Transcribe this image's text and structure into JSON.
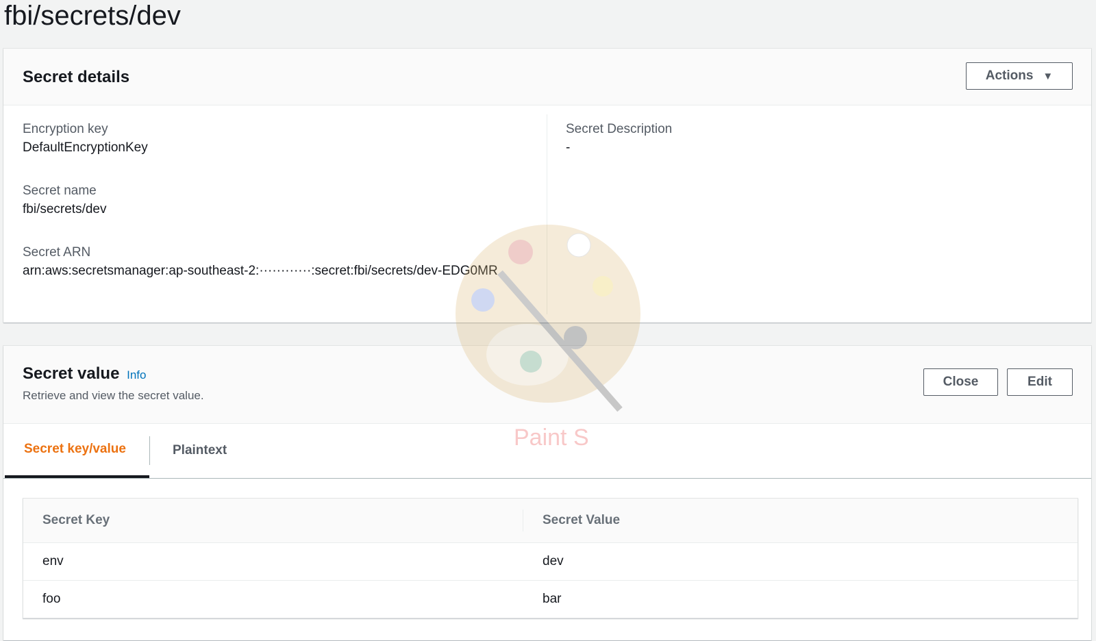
{
  "page": {
    "title": "fbi/secrets/dev"
  },
  "details": {
    "title": "Secret details",
    "actions_label": "Actions",
    "fields_left": [
      {
        "label": "Encryption key",
        "value": "DefaultEncryptionKey"
      },
      {
        "label": "Secret name",
        "value": "fbi/secrets/dev"
      },
      {
        "label": "Secret ARN",
        "value": "arn:aws:secretsmanager:ap-southeast-2:············:secret:fbi/secrets/dev-EDG0MR"
      }
    ],
    "fields_right": [
      {
        "label": "Secret Description",
        "value": "-"
      }
    ]
  },
  "secret_value": {
    "title": "Secret value",
    "info_label": "Info",
    "subtitle": "Retrieve and view the secret value.",
    "close_label": "Close",
    "edit_label": "Edit",
    "tabs": [
      {
        "label": "Secret key/value",
        "active": true
      },
      {
        "label": "Plaintext",
        "active": false
      }
    ],
    "table": {
      "headers": [
        "Secret Key",
        "Secret Value"
      ],
      "rows": [
        {
          "key": "env",
          "value": "dev"
        },
        {
          "key": "foo",
          "value": "bar"
        }
      ]
    }
  },
  "watermark": {
    "text": "Paint S",
    "icon": "palette-icon"
  },
  "colors": {
    "accent": "#ec7211",
    "link": "#0073bb",
    "text": "#16191f",
    "muted": "#545b64"
  }
}
